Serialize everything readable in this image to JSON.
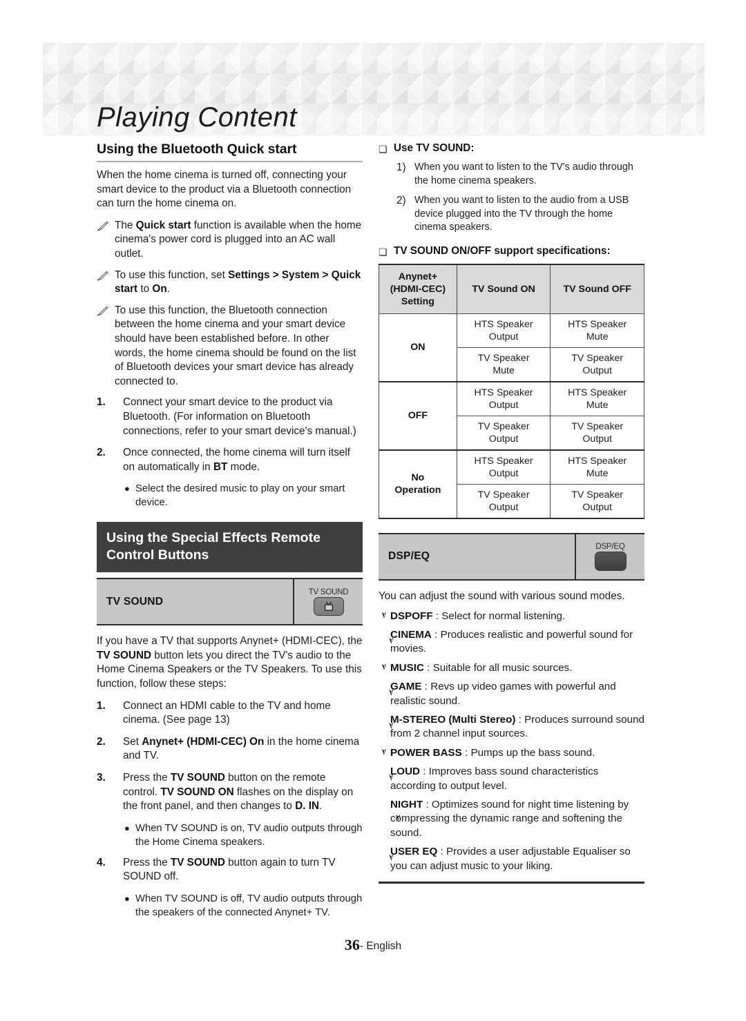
{
  "banner": {
    "title": "Playing Content"
  },
  "footer": {
    "page_number": "36",
    "separator": "-",
    "language": "English"
  },
  "left": {
    "section1": {
      "heading": "Using the Bluetooth Quick start",
      "intro": "When the home cinema is turned off, connecting your smart device to the product via a Bluetooth connection can turn the home cinema on.",
      "notes": [
        {
          "pre": "The ",
          "bold1": "Quick start",
          "post": " function is available when the home cinema's power cord is plugged into an AC wall outlet."
        },
        {
          "pre": "To use this function, set ",
          "bold1": "Settings > System > Quick start",
          "mid": " to ",
          "bold2": "On",
          "post": "."
        },
        {
          "pre": "To use this function, the Bluetooth connection between the home cinema and your smart device should have been established before. In other words, the home cinema should be found on the list of Bluetooth devices your smart device has already connected to."
        }
      ],
      "steps": [
        {
          "n": "1.",
          "text": "Connect your smart device to the product via Bluetooth. (For information on Bluetooth connections, refer to your smart device's manual.)"
        },
        {
          "n": "2.",
          "pre": "Once connected, the home cinema will turn itself on automatically in ",
          "bold": "BT",
          "post": " mode."
        }
      ],
      "substep": "Select the desired music to play on your smart device."
    },
    "section2": {
      "heading": "Using the Special Effects Remote Control Buttons",
      "feature": {
        "name": "TV SOUND",
        "key_label": "TV SOUND",
        "key_icon": "tv-icon"
      },
      "intro_a": "If you have a TV that supports Anynet+ (HDMI-CEC), the ",
      "intro_b": "TV SOUND",
      "intro_c": " button lets you direct the TV's audio to the Home Cinema Speakers or the TV Speakers. To use this function, follow these steps:",
      "steps": [
        {
          "n": "1.",
          "text": "Connect an HDMI cable to the TV and home cinema. (See page 13)"
        },
        {
          "n": "2.",
          "pre": "Set ",
          "bold": "Anynet+ (HDMI-CEC) On",
          "post": " in the home cinema and TV."
        },
        {
          "n": "3.",
          "pre": "Press the ",
          "bold": "TV SOUND",
          "mid": " button on the remote control. ",
          "bold2": "TV SOUND ON",
          "post": " flashes on the display on the front panel, and then changes to ",
          "bold3": "D. IN",
          "tail": "."
        },
        {
          "n": "4.",
          "pre": "Press the ",
          "bold": "TV SOUND",
          "post": " button again to turn TV SOUND off."
        }
      ],
      "sub3": "When TV SOUND is on, TV audio outputs through the Home Cinema speakers.",
      "sub4": "When TV SOUND is off, TV audio outputs through the speakers of the connected Anynet+ TV."
    }
  },
  "right": {
    "use_tv_sound": {
      "heading": "Use TV SOUND:",
      "items": [
        {
          "n": "1)",
          "text": "When you want to listen to the TV's audio through the home cinema speakers."
        },
        {
          "n": "2)",
          "text": "When you want to listen to the audio from a USB device plugged into the TV through the home cinema speakers."
        }
      ]
    },
    "spec_heading": "TV SOUND ON/OFF support specifications:",
    "table": {
      "headers": [
        "Anynet+ (HDMI-CEC) Setting",
        "TV Sound ON",
        "TV Sound OFF"
      ],
      "header_lines": [
        [
          "Anynet+",
          "(HDMI-CEC)",
          "Setting"
        ],
        [
          "TV Sound ON"
        ],
        [
          "TV Sound OFF"
        ]
      ],
      "rows": [
        {
          "setting": "ON",
          "cells": [
            {
              "on": [
                "HTS Speaker",
                "Output"
              ],
              "off": [
                "HTS Speaker",
                "Mute"
              ]
            },
            {
              "on": [
                "TV Speaker",
                "Mute"
              ],
              "off": [
                "TV Speaker",
                "Output"
              ]
            }
          ]
        },
        {
          "setting": "OFF",
          "cells": [
            {
              "on": [
                "HTS Speaker",
                "Output"
              ],
              "off": [
                "HTS Speaker",
                "Mute"
              ]
            },
            {
              "on": [
                "TV Speaker",
                "Output"
              ],
              "off": [
                "TV Speaker",
                "Output"
              ]
            }
          ]
        },
        {
          "setting": "No Operation",
          "setting_lines": [
            "No",
            "Operation"
          ],
          "cells": [
            {
              "on": [
                "HTS Speaker",
                "Output"
              ],
              "off": [
                "HTS Speaker",
                "Mute"
              ]
            },
            {
              "on": [
                "TV Speaker",
                "Output"
              ],
              "off": [
                "TV Speaker",
                "Output"
              ]
            }
          ]
        }
      ]
    },
    "dsp": {
      "feature": {
        "name": "DSP/EQ",
        "key_label": "DSP/EQ",
        "key_icon": "blank-key-icon"
      },
      "intro": "You can adjust the sound with various sound modes.",
      "modes": [
        {
          "label": "DSPOFF",
          "desc": " : Select for normal listening."
        },
        {
          "label": "CINEMA",
          "desc": " : Produces realistic and powerful sound for movies."
        },
        {
          "label": "MUSIC",
          "desc": " : Suitable for all music sources."
        },
        {
          "label": "GAME",
          "desc": " : Revs up video games with powerful and realistic sound."
        },
        {
          "label": "M-STEREO (Multi Stereo)",
          "desc": " : Produces surround sound from 2 channel input sources."
        },
        {
          "label": "POWER BASS",
          "desc": " : Pumps up the bass sound."
        },
        {
          "label": "LOUD",
          "desc": " : Improves bass sound characteristics according to output level."
        },
        {
          "label": "NIGHT",
          "desc": " : Optimizes sound for night time listening by compressing the dynamic range and softening the sound."
        },
        {
          "label": "USER EQ",
          "desc": " : Provides a user adjustable Equaliser so you can adjust music to your liking."
        }
      ]
    }
  }
}
